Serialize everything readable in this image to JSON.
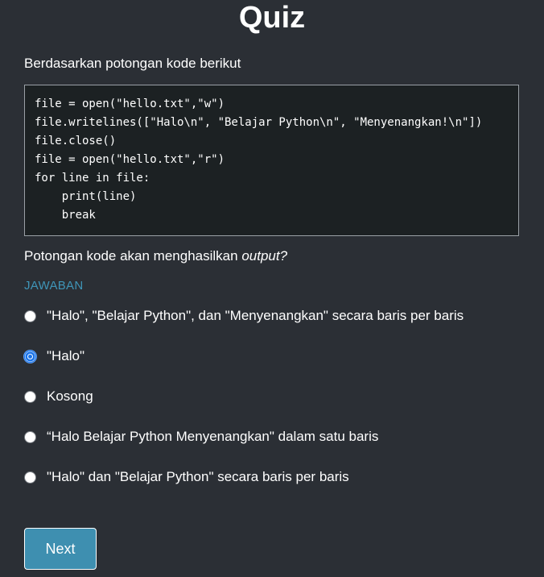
{
  "header": {
    "title": "Quiz"
  },
  "question": {
    "intro": "Berdasarkan potongan kode berikut",
    "code_lines": [
      "file = open(\"hello.txt\",\"w\")",
      "file.writelines([\"Halo\\n\", \"Belajar Python\\n\", \"Menyenangkan!\\n\"])",
      "file.close()",
      "file = open(\"hello.txt\",\"r\")",
      "for line in file:",
      "    print(line)",
      "    break"
    ],
    "prompt_prefix": "Potongan kode akan menghasilkan ",
    "prompt_emphasis": "output?"
  },
  "answers": {
    "label": "JAWABAN",
    "selected_index": 1,
    "options": [
      {
        "label": "\"Halo\", \"Belajar Python\", dan \"Menyenangkan\" secara baris per baris"
      },
      {
        "label": "\"Halo\""
      },
      {
        "label": "Kosong"
      },
      {
        "label": "“Halo Belajar Python Menyenangkan\" dalam satu baris"
      },
      {
        "label": "\"Halo\" dan \"Belajar Python\" secara baris per baris"
      }
    ]
  },
  "footer": {
    "next_label": "Next"
  },
  "colors": {
    "background": "#2b2f35",
    "code_background": "#1c2123",
    "accent": "#3e8fb0",
    "answer_label": "#3f95b8",
    "radio_selected": "#1a73e8"
  }
}
